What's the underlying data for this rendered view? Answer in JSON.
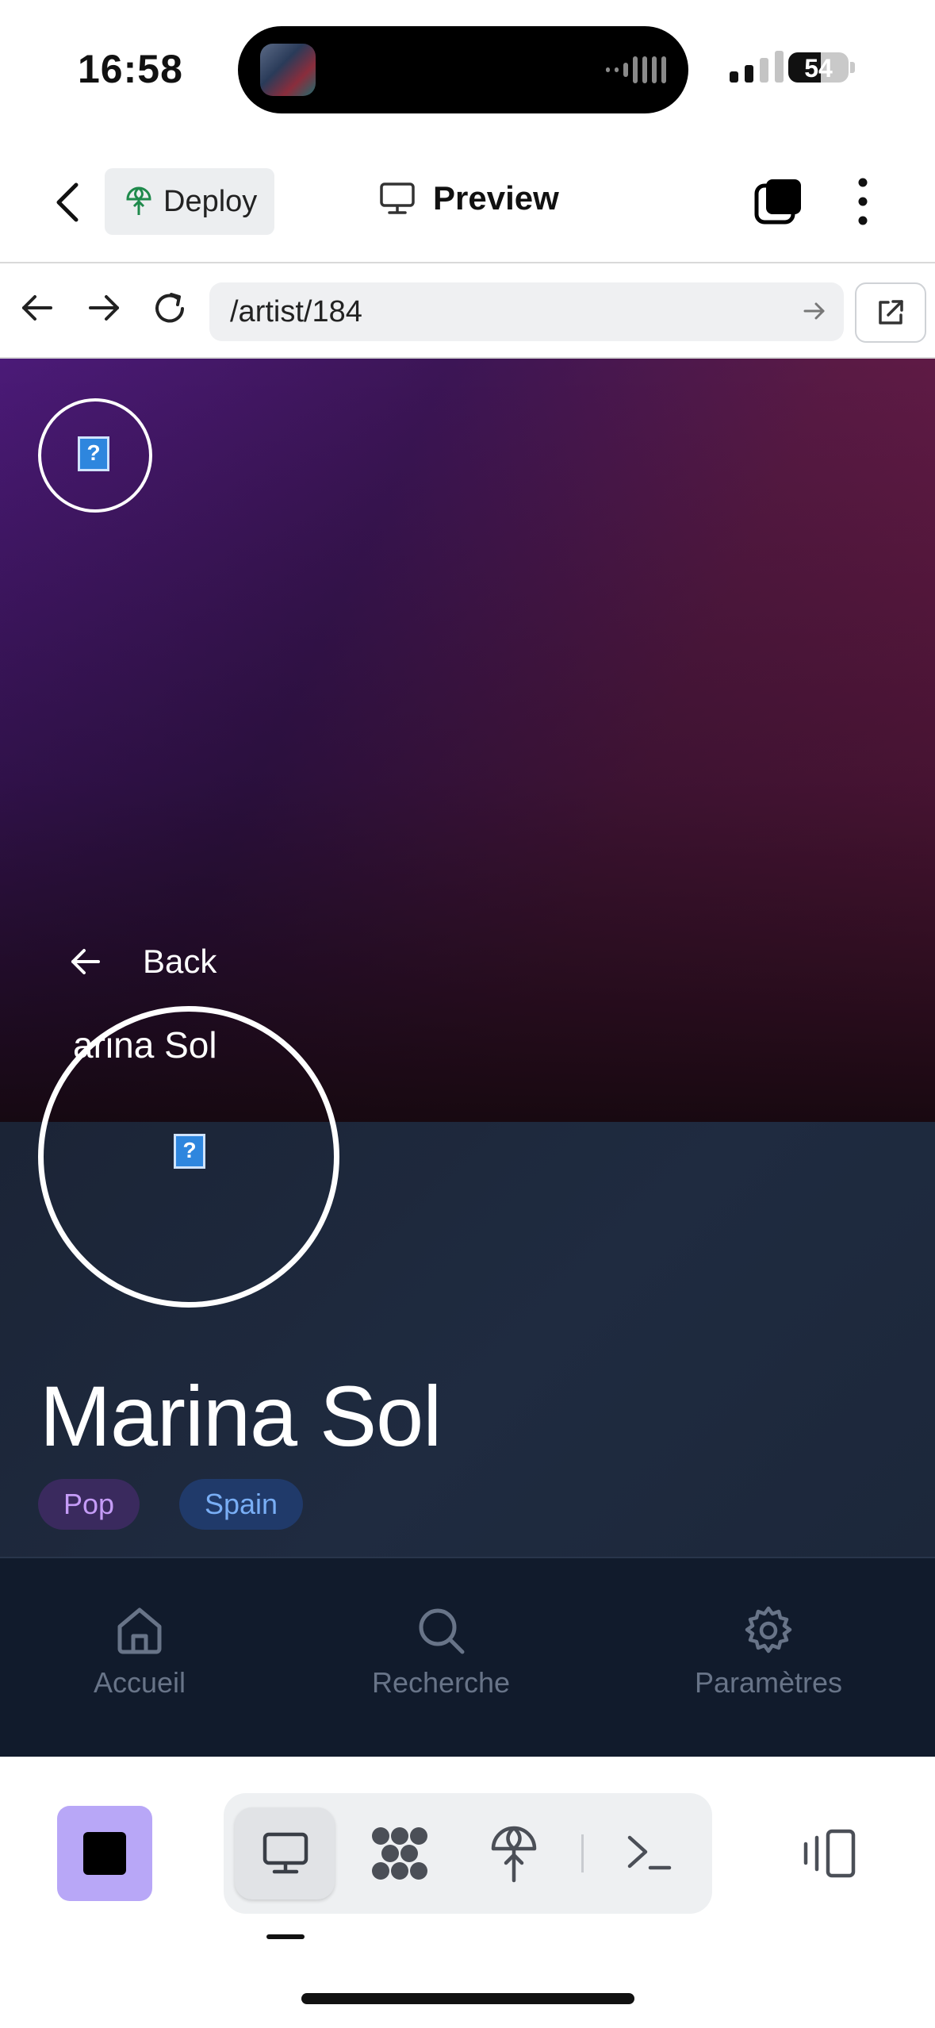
{
  "status_bar": {
    "time": "16:58",
    "battery": "54",
    "battery_level": 0.54
  },
  "top_bar": {
    "deploy_label": "Deploy",
    "preview_label": "Preview"
  },
  "browser": {
    "url": "/artist/184"
  },
  "hero": {
    "back_label": "Back",
    "name_overlay": "arina Sol"
  },
  "artist": {
    "name": "Marina Sol",
    "tags": [
      "Pop",
      "Spain"
    ]
  },
  "tabs": [
    {
      "label": "Accueil",
      "icon": "home-icon"
    },
    {
      "label": "Recherche",
      "icon": "search-icon"
    },
    {
      "label": "Paramètres",
      "icon": "gear-icon"
    }
  ],
  "colors": {
    "accent_purple": "#b8a7f7",
    "tag_pop_text": "#c59cf7",
    "tag_country_text": "#79aef5",
    "tab_inactive": "#687488"
  }
}
